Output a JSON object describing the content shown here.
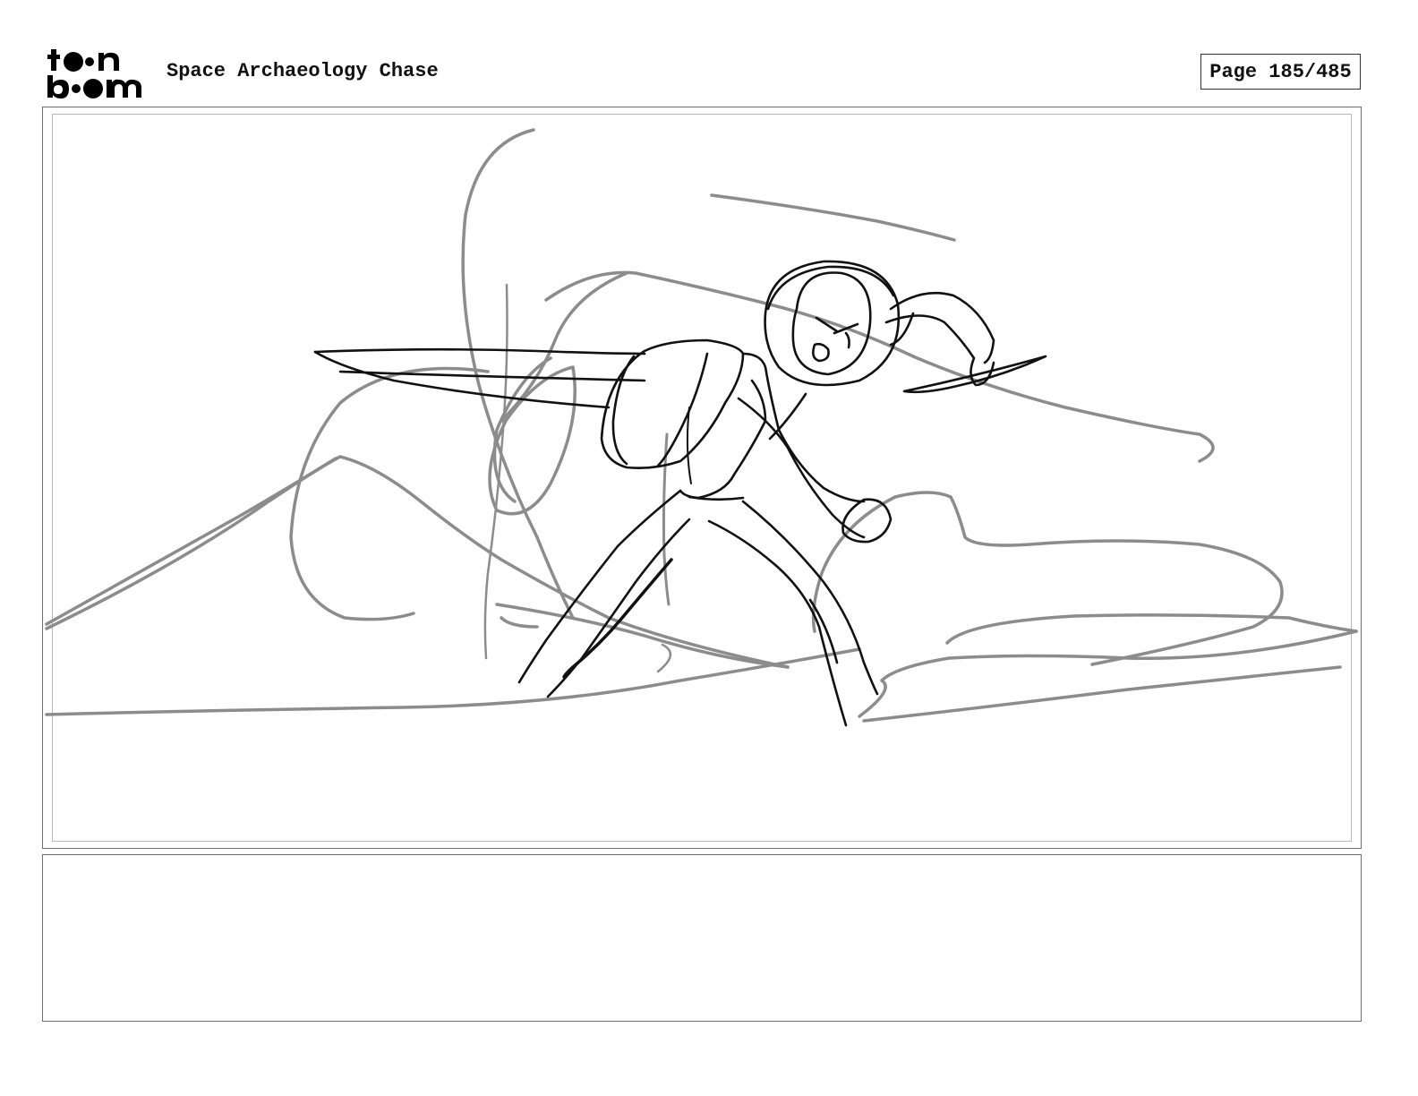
{
  "header": {
    "logo": {
      "line1": "toon",
      "line2": "boom",
      "brand_color": "#000000"
    },
    "project_title": "Space Archaeology Chase",
    "page_label": "Page 185/485"
  },
  "panel": {
    "sketch_colors": {
      "rough": "#8c8c8c",
      "clean": "#111111"
    }
  },
  "notes": {
    "text": ""
  }
}
